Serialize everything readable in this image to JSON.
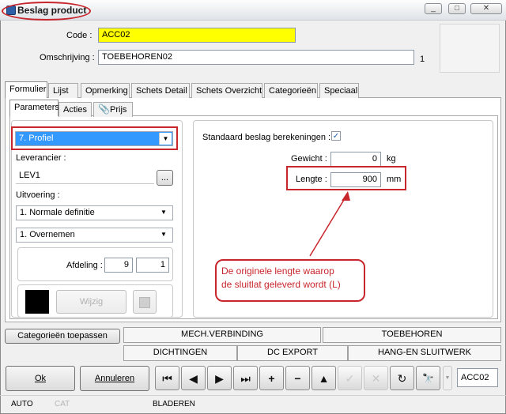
{
  "window": {
    "title": "Beslag product"
  },
  "header": {
    "code_label": "Code :",
    "code_value": "ACC02",
    "omschrijving_label": "Omschrijving :",
    "omschrijving_value": "TOEBEHOREN02",
    "omschrijving_suffix": "1"
  },
  "tabs": [
    "Formulier",
    "Lijst",
    "Opmerking",
    "Schets Detail",
    "Schets Overzicht",
    "Categorieën",
    "Speciaal"
  ],
  "subtabs": [
    "Parameters",
    "Acties",
    "Prijs"
  ],
  "left": {
    "type_value": "7.  Profiel",
    "leverancier_label": "Leverancier :",
    "leverancier_value": "LEV1",
    "browse_label": "...",
    "uitvoering_label": "Uitvoering :",
    "uitvoering_value": "1.  Normale definitie",
    "second_combo_value": "1.  Overnemen",
    "afdeling_label": "Afdeling :",
    "afdeling_value1": "9",
    "afdeling_value2": "1",
    "color_swatch": "#000000",
    "wijzig_label": "Wijzig"
  },
  "right": {
    "standaard_label": "Standaard beslag berekeningen :",
    "standaard_checked": "✓",
    "gewicht_label": "Gewicht :",
    "gewicht_value": "0",
    "gewicht_unit": "kg",
    "lengte_label": "Lengte :",
    "lengte_value": "900",
    "lengte_unit": "mm"
  },
  "callout": {
    "line1": "De originele lengte waarop",
    "line2": "de sluitlat geleverd wordt (L)"
  },
  "categories": {
    "apply_label": "Categorieën toepassen",
    "row1": [
      "MECH.VERBINDING",
      "TOEBEHOREN"
    ],
    "row2": [
      "DICHTINGEN",
      "DC EXPORT",
      "HANG-EN SLUITWERK"
    ]
  },
  "toolbar": {
    "ok_label": "Ok",
    "annuleren_label": "Annuleren",
    "nav_glyphs": [
      "⏮",
      "◀",
      "▶",
      "⏭",
      "+",
      "−",
      "▲",
      "✓",
      "✕",
      "↻",
      "🔭"
    ],
    "current_code": "ACC02"
  },
  "statusbar": {
    "auto": "AUTO",
    "cat": "CAT",
    "mode": "BLADEREN"
  },
  "colors": {
    "highlight": "#c8262d",
    "field_yellow": "#ffff00",
    "selection_blue": "#3399ff"
  }
}
